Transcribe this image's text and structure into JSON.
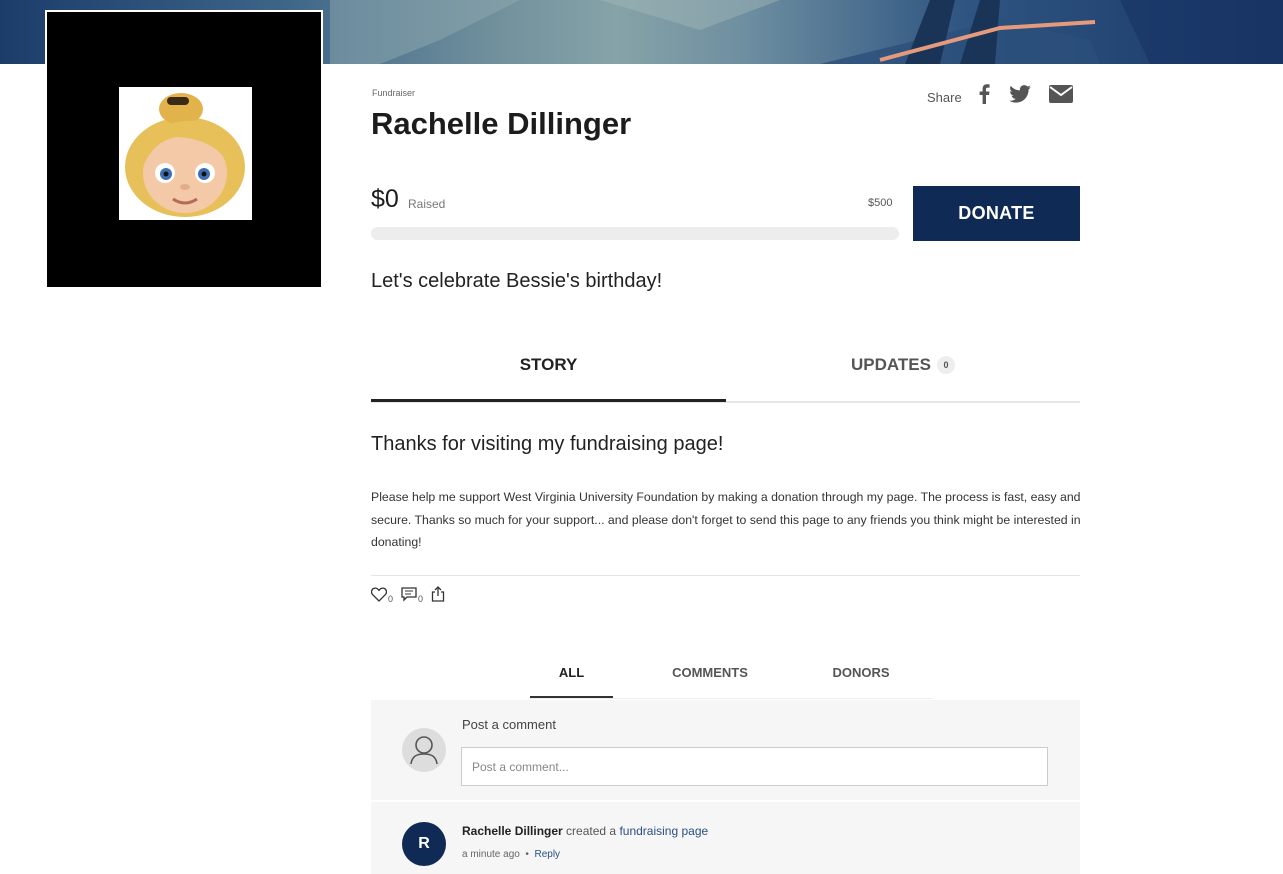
{
  "header": {
    "role_label": "Fundraiser",
    "fundraiser_name": "Rachelle Dillinger",
    "share_label": "Share",
    "share_icons": [
      "facebook-icon",
      "twitter-icon",
      "email-icon"
    ]
  },
  "progress": {
    "raised_amount": "$0",
    "raised_label": "Raised",
    "goal_amount": "$500",
    "fraction": 0,
    "donate_label": "DONATE"
  },
  "headline": "Let's celebrate Bessie's birthday!",
  "tabs": [
    {
      "label": "STORY",
      "active": true
    },
    {
      "label": "UPDATES",
      "badge": "0",
      "active": false
    }
  ],
  "story": {
    "title": "Thanks for visiting my fundraising page!",
    "body": "Please help me support West Virginia University Foundation by making a donation through my page. The process is fast, easy and secure. Thanks so much for your support... and please don't forget to send this page to any friends you think might be interested in donating!"
  },
  "reactions": {
    "likes": "0",
    "comments": "0"
  },
  "feed_tabs": [
    {
      "label": "ALL",
      "active": true
    },
    {
      "label": "COMMENTS",
      "active": false
    },
    {
      "label": "DONORS",
      "active": false
    }
  ],
  "comment": {
    "label": "Post a comment",
    "placeholder": "Post a comment..."
  },
  "activity": {
    "avatar_initial": "R",
    "user": "Rachelle Dillinger",
    "action": "created a",
    "link": "fundraising page",
    "time": "a minute ago",
    "separator": "•",
    "reply": "Reply"
  },
  "colors": {
    "brand_navy": "#0f2a55",
    "link_blue": "#2a4f86"
  }
}
